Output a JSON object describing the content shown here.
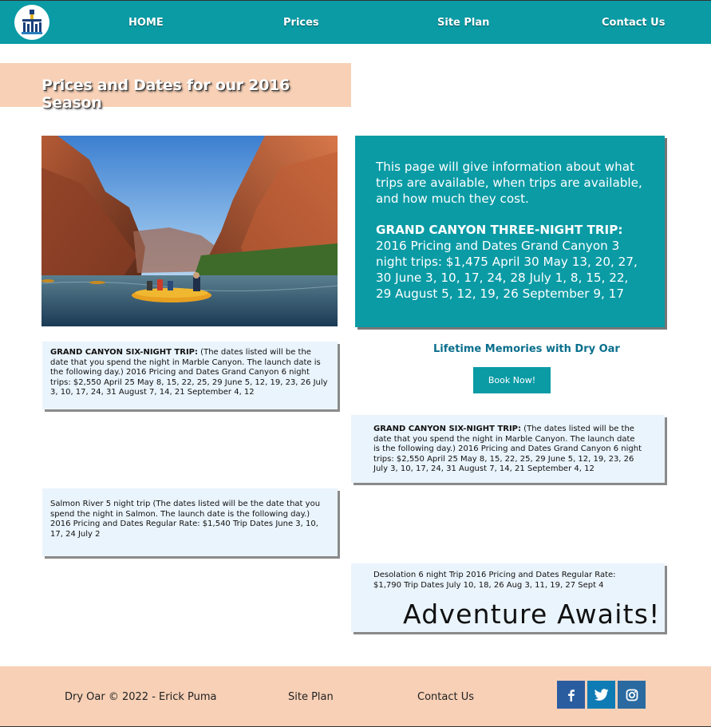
{
  "nav": {
    "logo_label": "logo",
    "links": [
      "HOME",
      "Prices",
      "Site Plan",
      "Contact Us"
    ]
  },
  "page_title": "Prices and Dates for our 2016 Season",
  "info_box": {
    "intro": "This page will give information about what trips are available, when trips are available, and how much they cost.",
    "three_night_heading": "GRAND CANYON THREE-NIGHT TRIP:",
    "three_night_body": " 2016 Pricing and Dates Grand Canyon 3 night trips: $1,475 April 30 May 13, 20, 27, 30 June 3, 10, 17, 24, 28 July 1, 8, 15, 22, 29 August 5, 12, 19, 26 September 9, 17"
  },
  "card_left_1": {
    "heading": "GRAND CANYON SIX-NIGHT TRIP:",
    "body": " (The dates listed will be the date that you spend the night in Marble Canyon. The launch date is the following day.) 2016 Pricing and Dates Grand Canyon 6 night trips: $2,550 April 25 May 8, 15, 22, 25, 29 June 5, 12, 19, 23, 26 July 3, 10, 17, 24, 31 August 7, 14, 21 September 4, 12"
  },
  "memories_text": "Lifetime Memories with Dry Oar",
  "book_button": "Book Now!",
  "card_right_1": {
    "heading": "GRAND CANYON SIX-NIGHT TRIP:",
    "body": " (The dates listed will be the date that you spend the night in Marble Canyon. The launch date is the following day.) 2016 Pricing and Dates Grand Canyon 6 night trips: $2,550 April 25 May 8, 15, 22, 25, 29 June 5, 12, 19, 23, 26 July 3, 10, 17, 24, 31 August 7, 14, 21 September 4, 12"
  },
  "card_left_2": {
    "body": "Salmon River 5 night trip (The dates listed will be the date that you spend the night in Salmon. The launch date is the following day.) 2016 Pricing and Dates Regular Rate: $1,540 Trip Dates June 3, 10, 17, 24 July 2"
  },
  "card_right_2": {
    "body": "Desolation 6 night Trip 2016 Pricing and Dates Regular Rate: $1,790 Trip Dates July 10, 18, 26 Aug 3, 11, 19, 27 Sept 4",
    "tagline": "Adventure Awaits!"
  },
  "footer": {
    "copyright": "Dry Oar © 2022 - Erick Puma",
    "site_plan": "Site Plan",
    "contact": "Contact Us",
    "social": [
      "facebook-icon",
      "twitter-icon",
      "instagram-icon"
    ]
  },
  "colors": {
    "teal": "#0a9ba5",
    "peach": "#f7d0b6",
    "card_bg": "#eaf4fc"
  }
}
